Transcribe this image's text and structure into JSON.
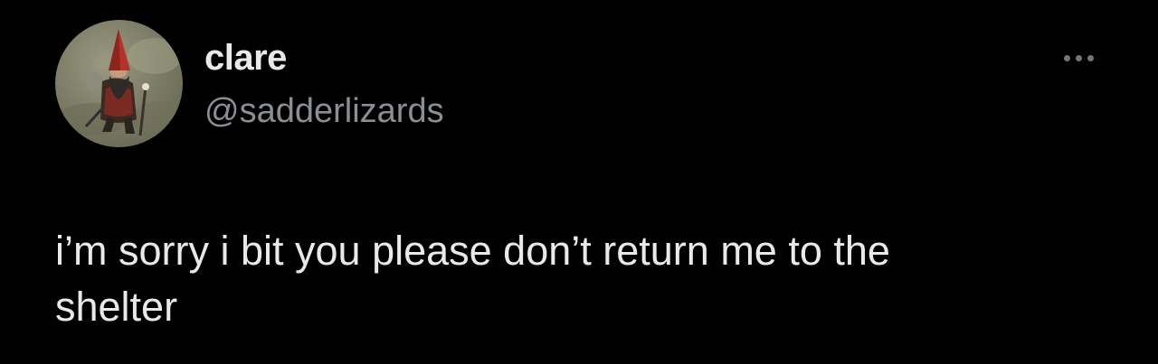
{
  "tweet": {
    "author": {
      "display_name": "clare",
      "handle": "@sadderlizards",
      "avatar_icon": "gnome-avatar-icon"
    },
    "more_icon": "more-options-icon",
    "text": "i’m sorry i bit you please don’t return me to the\nshelter"
  },
  "colors": {
    "background": "#000000",
    "primary_text": "#e7e9ea",
    "secondary_text": "#8b8f94",
    "icon": "#71767b"
  }
}
